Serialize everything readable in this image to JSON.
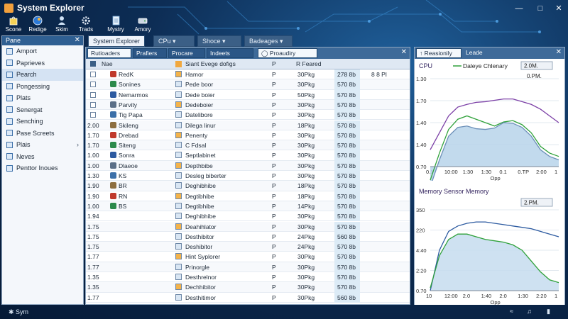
{
  "app": {
    "title": "System Explorer"
  },
  "toolbar": {
    "buttons": [
      {
        "label": "Scone",
        "icon": "bag-icon"
      },
      {
        "label": "Redige",
        "icon": "globe-icon"
      },
      {
        "label": "Skim",
        "icon": "person-icon"
      },
      {
        "label": "Trads",
        "icon": "gear-icon"
      },
      {
        "label": "Mystry",
        "icon": "document-icon"
      },
      {
        "label": "Amory",
        "icon": "drive-icon"
      }
    ]
  },
  "nav": {
    "header": "Pane",
    "items": [
      {
        "label": "Amport"
      },
      {
        "label": "Paprieves"
      },
      {
        "label": "Pearch"
      },
      {
        "label": "Pongessing"
      },
      {
        "label": "Plats"
      },
      {
        "label": "Senergat"
      },
      {
        "label": "Senching"
      },
      {
        "label": "Pase Screets"
      },
      {
        "label": "Plais"
      },
      {
        "label": "Neves"
      },
      {
        "label": "Penttor Inoues"
      }
    ]
  },
  "doc_tabs": [
    {
      "label": "System Explorer"
    },
    {
      "label": "CPu"
    },
    {
      "label": "Shoce"
    },
    {
      "label": "Badeages"
    }
  ],
  "sub_tabs": [
    {
      "label": "Rutioaders"
    },
    {
      "label": "Prafiers"
    },
    {
      "label": "Procare"
    },
    {
      "label": "Indeets"
    },
    {
      "label": "Proaudiry"
    }
  ],
  "grid": {
    "columns": [
      "Nae",
      "Siant Evege dofigs",
      "R Feared"
    ],
    "rows": [
      {
        "num": "",
        "name": "RedK",
        "sel": false,
        "descr": "Hamor",
        "p": "P",
        "mem": "30Pkg",
        "v": "278 8b",
        "flag": "8 8 Pl"
      },
      {
        "num": "",
        "name": "Sonines",
        "sel": false,
        "descr": "Pede boor",
        "p": "P",
        "mem": "30Pkg",
        "v": "570 8b",
        "flag": ""
      },
      {
        "num": "",
        "name": "Nemarmos",
        "sel": false,
        "descr": "Dede boier",
        "p": "P",
        "mem": "50Pkg",
        "v": "570 8b",
        "flag": ""
      },
      {
        "num": "",
        "name": "Parvity",
        "sel": false,
        "descr": "Dedeboier",
        "p": "P",
        "mem": "30Pkg",
        "v": "570 8b",
        "flag": ""
      },
      {
        "num": "",
        "name": "Tig Papa",
        "sel": false,
        "descr": "Datelibore",
        "p": "P",
        "mem": "30Pkg",
        "v": "570 8b",
        "flag": ""
      },
      {
        "num": "2.00",
        "name": "Skileng",
        "sel": false,
        "descr": "Dilega linur",
        "p": "P",
        "mem": "18Pkg",
        "v": "570 8b",
        "flag": ""
      },
      {
        "num": "1.70",
        "name": "Drebad",
        "sel": false,
        "descr": "Penenty",
        "p": "P",
        "mem": "30Pkg",
        "v": "570 8b",
        "flag": ""
      },
      {
        "num": "1.70",
        "name": "Siteng",
        "sel": false,
        "descr": "C Fdsal",
        "p": "P",
        "mem": "30Pkg",
        "v": "570 8b",
        "flag": ""
      },
      {
        "num": "1.00",
        "name": "Sonra",
        "sel": false,
        "descr": "Septlabinet",
        "p": "P",
        "mem": "30Pkg",
        "v": "570 8b",
        "flag": ""
      },
      {
        "num": "1.00",
        "name": "Dlaeoe",
        "sel": false,
        "descr": "Depthbibe",
        "p": "P",
        "mem": "30Pkg",
        "v": "570 8b",
        "flag": ""
      },
      {
        "num": "1.30",
        "name": "KS",
        "sel": false,
        "descr": "Desleg biberter",
        "p": "P",
        "mem": "30Pkg",
        "v": "570 8b",
        "flag": ""
      },
      {
        "num": "1.90",
        "name": "BR",
        "sel": false,
        "descr": "Deghibhibe",
        "p": "P",
        "mem": "18Pkg",
        "v": "570 8b",
        "flag": ""
      },
      {
        "num": "1.90",
        "name": "RN",
        "sel": false,
        "descr": "Degtibhibe",
        "p": "P",
        "mem": "18Pkg",
        "v": "570 8b",
        "flag": ""
      },
      {
        "num": "1.00",
        "name": "BS",
        "sel": false,
        "descr": "Degtibhibe",
        "p": "P",
        "mem": "14Pkg",
        "v": "570 8b",
        "flag": ""
      },
      {
        "num": "1.94",
        "name": "",
        "sel": false,
        "descr": "Deghibhibe",
        "p": "P",
        "mem": "30Pkg",
        "v": "570 8b",
        "flag": ""
      },
      {
        "num": "1.75",
        "name": "",
        "sel": false,
        "descr": "Deahihlator",
        "p": "P",
        "mem": "30Pkg",
        "v": "570 8b",
        "flag": ""
      },
      {
        "num": "1.75",
        "name": "",
        "sel": false,
        "descr": "Desthibitor",
        "p": "P",
        "mem": "24Pkg",
        "v": "560 8b",
        "flag": ""
      },
      {
        "num": "1.75",
        "name": "",
        "sel": false,
        "descr": "Deshibitor",
        "p": "P",
        "mem": "24Pkg",
        "v": "570 8b",
        "flag": ""
      },
      {
        "num": "1.77",
        "name": "",
        "sel": false,
        "descr": "Hint Syplorer",
        "p": "P",
        "mem": "30Pkg",
        "v": "570 8b",
        "flag": ""
      },
      {
        "num": "1.77",
        "name": "",
        "sel": false,
        "descr": "Prinorgle",
        "p": "P",
        "mem": "30Pkg",
        "v": "570 8b",
        "flag": ""
      },
      {
        "num": "1.35",
        "name": "",
        "sel": false,
        "descr": "Desthrelnor",
        "p": "P",
        "mem": "30Pkg",
        "v": "570 8b",
        "flag": ""
      },
      {
        "num": "1.35",
        "name": "",
        "sel": false,
        "descr": "Dechhibitor",
        "p": "P",
        "mem": "30Pkg",
        "v": "570 8b",
        "flag": ""
      },
      {
        "num": "1.77",
        "name": "",
        "sel": false,
        "descr": "Desthitimor",
        "p": "P",
        "mem": "30Pkg",
        "v": "560 8b",
        "flag": ""
      }
    ]
  },
  "right": {
    "tabs": [
      {
        "label": "Reasionily"
      },
      {
        "label": "Leade"
      }
    ],
    "cpu": {
      "title": "CPU",
      "legend": "Daleye Chlenary",
      "badge": "2.0M.",
      "badge2": "0.PM.",
      "yticks": [
        "1.30",
        "1.70",
        "1.40",
        "1.40",
        "0.70"
      ],
      "xticks": [
        "0.1",
        "10:00",
        "1:30",
        "1:30",
        "0.1",
        "0.TP",
        "2:00",
        "1"
      ],
      "xlabel": "Opp"
    },
    "mem": {
      "title": "Memory Sensor Memory",
      "badge": "2.PM.",
      "yticks": [
        "350",
        "220",
        "4:40",
        "2:20",
        "0.70"
      ],
      "xticks": [
        "10",
        "12:00",
        "2.0",
        "1:40",
        "2:0",
        "1:30",
        "2:20",
        "1"
      ],
      "xlabel": "Opp"
    }
  },
  "status": {
    "text": "Sym"
  },
  "colors": {
    "accent": "#2f5f92",
    "cpu_fill": "#b7d3ea",
    "cpu_line_purple": "#7b3fa6",
    "cpu_line_green": "#2fa13a",
    "mem_line": "#2c5aa0",
    "mem_fill": "#c6dcef"
  },
  "chart_data": [
    {
      "type": "area",
      "title": "CPU",
      "series": [
        {
          "name": "Daleye Chlenary",
          "values": [
            0.95,
            1.2,
            1.45,
            1.58,
            1.62,
            1.65,
            1.66,
            1.68,
            1.7,
            1.7,
            1.66,
            1.62,
            1.55,
            1.45,
            1.35
          ]
        },
        {
          "name": "",
          "values": [
            0.5,
            0.9,
            1.25,
            1.4,
            1.45,
            1.4,
            1.35,
            1.3,
            1.36,
            1.38,
            1.32,
            1.2,
            1.0,
            0.9,
            0.85
          ]
        },
        {
          "name": "",
          "values": [
            0.4,
            0.8,
            1.15,
            1.28,
            1.3,
            1.26,
            1.25,
            1.27,
            1.35,
            1.34,
            1.28,
            1.15,
            0.95,
            0.85,
            0.8
          ]
        }
      ],
      "ylim": [
        0.7,
        2.0
      ],
      "xlabel": "Opp"
    },
    {
      "type": "area",
      "title": "Memory Sensor Memory",
      "series": [
        {
          "name": "",
          "values": [
            0.5,
            2.0,
            2.7,
            2.9,
            3.0,
            3.05,
            3.05,
            3.0,
            2.95,
            2.9,
            2.85,
            2.8,
            2.7,
            2.6,
            2.5
          ]
        },
        {
          "name": "",
          "values": [
            0.6,
            1.8,
            2.4,
            2.6,
            2.6,
            2.5,
            2.4,
            2.35,
            2.3,
            2.2,
            2.0,
            1.6,
            1.2,
            0.9,
            0.8
          ]
        }
      ],
      "ylim": [
        0.5,
        3.5
      ],
      "xlabel": "Opp"
    }
  ]
}
